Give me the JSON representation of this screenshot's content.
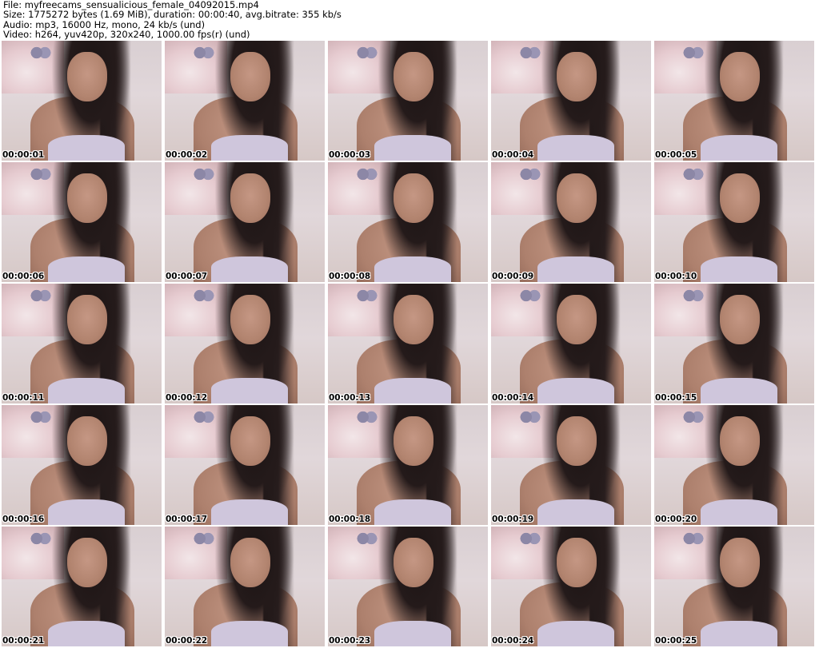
{
  "header": {
    "file_line": "File: myfreecams_sensualicious_female_04092015.mp4",
    "size_line": "Size: 1775272 bytes (1.69 MiB), duration: 00:00:40, avg.bitrate: 355 kb/s",
    "audio_line": "Audio: mp3, 16000 Hz, mono, 24 kb/s (und)",
    "video_line": "Video: h264, yuv420p, 320x240, 1000.00 fps(r) (und)"
  },
  "thumbnails": [
    {
      "timestamp": "00:00:01"
    },
    {
      "timestamp": "00:00:02"
    },
    {
      "timestamp": "00:00:03"
    },
    {
      "timestamp": "00:00:04"
    },
    {
      "timestamp": "00:00:05"
    },
    {
      "timestamp": "00:00:06"
    },
    {
      "timestamp": "00:00:07"
    },
    {
      "timestamp": "00:00:08"
    },
    {
      "timestamp": "00:00:09"
    },
    {
      "timestamp": "00:00:10"
    },
    {
      "timestamp": "00:00:11"
    },
    {
      "timestamp": "00:00:12"
    },
    {
      "timestamp": "00:00:13"
    },
    {
      "timestamp": "00:00:14"
    },
    {
      "timestamp": "00:00:15"
    },
    {
      "timestamp": "00:00:16"
    },
    {
      "timestamp": "00:00:17"
    },
    {
      "timestamp": "00:00:18"
    },
    {
      "timestamp": "00:00:19"
    },
    {
      "timestamp": "00:00:20"
    },
    {
      "timestamp": "00:00:21"
    },
    {
      "timestamp": "00:00:22"
    },
    {
      "timestamp": "00:00:23"
    },
    {
      "timestamp": "00:00:24"
    },
    {
      "timestamp": "00:00:25"
    }
  ]
}
